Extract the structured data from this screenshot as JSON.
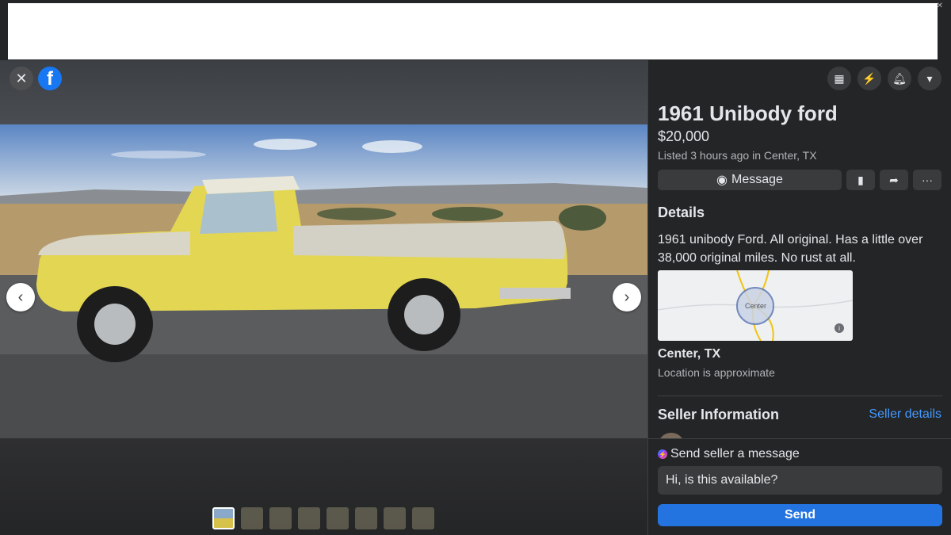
{
  "listing": {
    "title": "1961 Unibody ford",
    "price": "$20,000",
    "listed": "Listed 3 hours ago in Center, TX",
    "details_heading": "Details",
    "description": "1961 unibody Ford. All original.  Has a little over 38,000 original  miles. No rust at all.",
    "map_label": "Center",
    "location": "Center, TX",
    "location_note": "Location is approximate"
  },
  "actions": {
    "message_label": "Message",
    "save_icon": "bookmark-icon",
    "share_icon": "share-icon",
    "more_label": "···"
  },
  "seller": {
    "heading": "Seller Information",
    "details_link": "Seller details"
  },
  "compose": {
    "label": "Send seller a message",
    "input_value": "Hi, is this available?",
    "send_label": "Send"
  },
  "viewer": {
    "close_label": "✕",
    "logo_label": "f",
    "prev_label": "‹",
    "next_label": "›",
    "thumbnail_count": 8
  },
  "colors": {
    "accent": "#2374e1",
    "link": "#4599ff",
    "panel_bg": "#242526"
  }
}
